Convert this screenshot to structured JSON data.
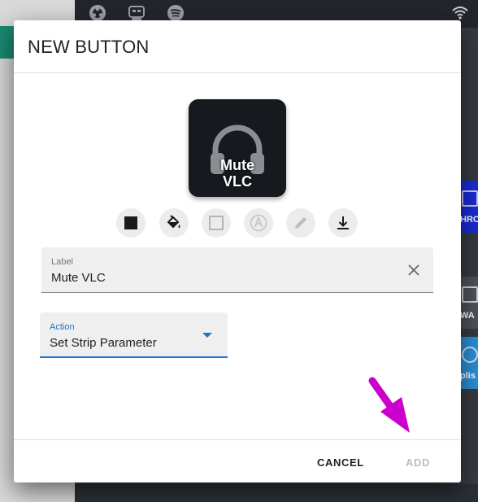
{
  "dialog": {
    "title": "NEW BUTTON",
    "preview": {
      "label": "Mute\nVLC",
      "icon": "headphones-icon",
      "background": "#16191e"
    },
    "style_tools": [
      "background-color-icon",
      "fill-bucket-icon",
      "border-icon",
      "text-style-icon",
      "pen-icon",
      "download-icon"
    ],
    "label_field": {
      "label": "Label",
      "value": "Mute VLC"
    },
    "action_field": {
      "label": "Action",
      "value": "Set Strip Parameter"
    },
    "footer": {
      "cancel": "CANCEL",
      "add": "ADD"
    }
  },
  "background": {
    "tiles": [
      "HRO",
      "WA",
      "plis"
    ]
  },
  "colors": {
    "accent": "#1976d2",
    "annotation_arrow": "#cc00cc"
  }
}
